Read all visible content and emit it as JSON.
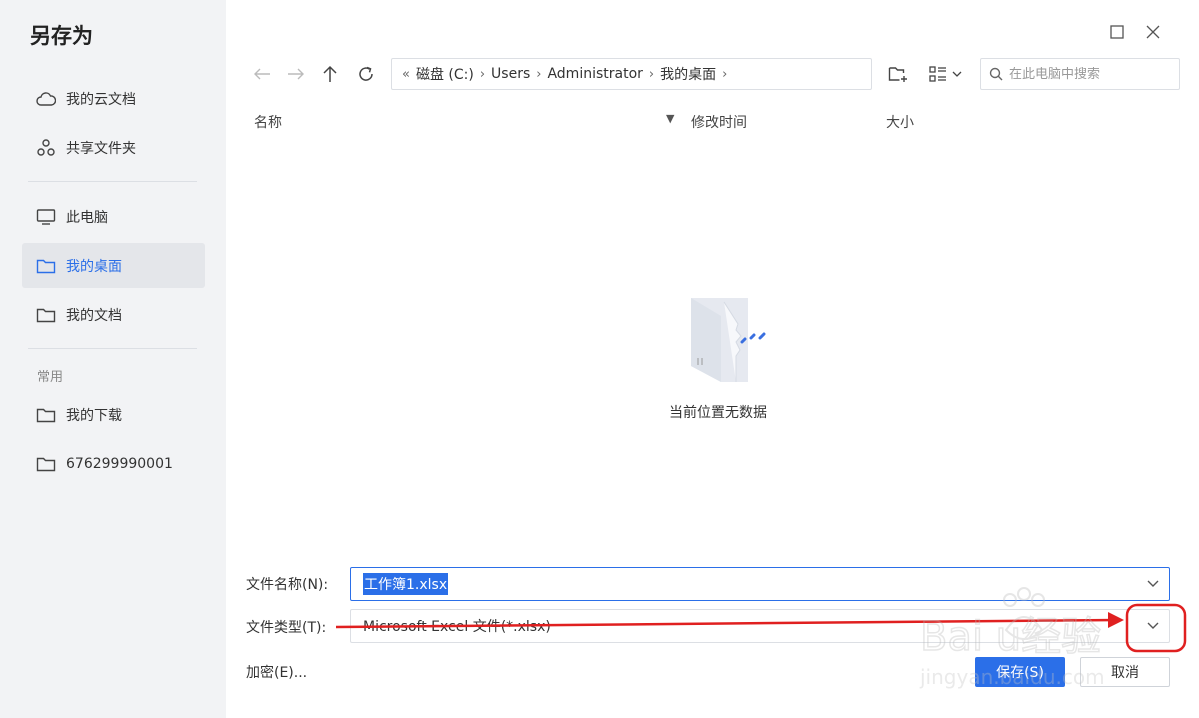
{
  "dialog": {
    "title": "另存为"
  },
  "sidebar": {
    "items": [
      {
        "label": "我的云文档",
        "icon": "cloud-icon"
      },
      {
        "label": "共享文件夹",
        "icon": "share-icon"
      },
      {
        "label": "此电脑",
        "icon": "monitor-icon"
      },
      {
        "label": "我的桌面",
        "icon": "folder-icon",
        "active": true
      },
      {
        "label": "我的文档",
        "icon": "folder-icon"
      },
      {
        "label": "我的下载",
        "icon": "folder-icon"
      },
      {
        "label": "676299990001",
        "icon": "folder-icon"
      }
    ],
    "section_label": "常用"
  },
  "breadcrumb": {
    "segments": [
      "磁盘 (C:)",
      "Users",
      "Administrator",
      "我的桌面"
    ]
  },
  "search": {
    "placeholder": "在此电脑中搜索"
  },
  "columns": {
    "name": "名称",
    "modified": "修改时间",
    "size": "大小"
  },
  "empty_state": {
    "text": "当前位置无数据"
  },
  "form": {
    "filename_label": "文件名称(N):",
    "filename_value": "工作簿1.xlsx",
    "filetype_label": "文件类型(T):",
    "filetype_value": "Microsoft Excel 文件(*.xlsx)",
    "encrypt_label": "加密(E)...",
    "save_label": "保存(S)",
    "cancel_label": "取消"
  },
  "colors": {
    "accent": "#2b6fe8",
    "annotation": "#e02020"
  },
  "watermark": {
    "text": "Baidu经验 jingyan.baidu.com"
  }
}
